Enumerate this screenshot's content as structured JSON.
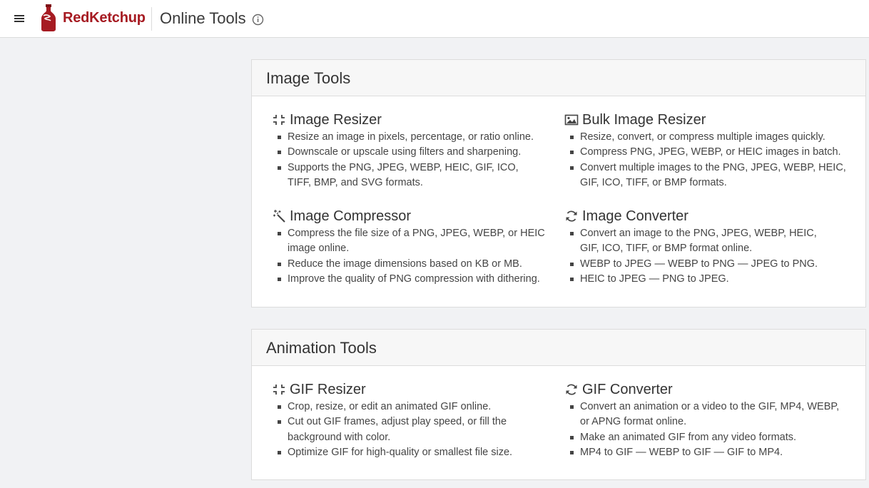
{
  "header": {
    "brand": "RedKetchup",
    "title": "Online Tools",
    "icons": {
      "menu": "hamburger-menu-icon",
      "logo": "ketchup-bottle-logo",
      "info": "info-icon"
    },
    "brand_color": "#a61b22"
  },
  "sections": [
    {
      "title": "Image Tools",
      "tools": [
        {
          "name": "Image Resizer",
          "icon": "resize-icon",
          "features": [
            "Resize an image in pixels, percentage, or ratio online.",
            "Downscale or upscale using filters and sharpening.",
            "Supports the PNG, JPEG, WEBP, HEIC, GIF, ICO, TIFF, BMP, and SVG formats."
          ]
        },
        {
          "name": "Bulk Image Resizer",
          "icon": "images-icon",
          "features": [
            "Resize, convert, or compress multiple images quickly.",
            "Compress PNG, JPEG, WEBP, or HEIC images in batch.",
            "Convert multiple images to the PNG, JPEG, WEBP, HEIC, GIF, ICO, TIFF, or BMP formats."
          ]
        },
        {
          "name": "Image Compressor",
          "icon": "magic-wand-icon",
          "features": [
            "Compress the file size of a PNG, JPEG, WEBP, or HEIC image online.",
            "Reduce the image dimensions based on KB or MB.",
            "Improve the quality of PNG compression with dithering."
          ]
        },
        {
          "name": "Image Converter",
          "icon": "convert-icon",
          "features": [
            "Convert an image to the PNG, JPEG, WEBP, HEIC, GIF, ICO, TIFF, or BMP format online.",
            "WEBP to JPEG — WEBP to PNG — JPEG to PNG.",
            "HEIC to JPEG — PNG to JPEG."
          ]
        }
      ]
    },
    {
      "title": "Animation Tools",
      "tools": [
        {
          "name": "GIF Resizer",
          "icon": "resize-icon",
          "features": [
            "Crop, resize, or edit an animated GIF online.",
            "Cut out GIF frames, adjust play speed, or fill the background with color.",
            "Optimize GIF for high-quality or smallest file size."
          ]
        },
        {
          "name": "GIF Converter",
          "icon": "convert-icon",
          "features": [
            "Convert an animation or a video to the GIF, MP4, WEBP, or APNG format online.",
            "Make an animated GIF from any video formats.",
            "MP4 to GIF — WEBP to GIF — GIF to MP4."
          ]
        }
      ]
    }
  ]
}
